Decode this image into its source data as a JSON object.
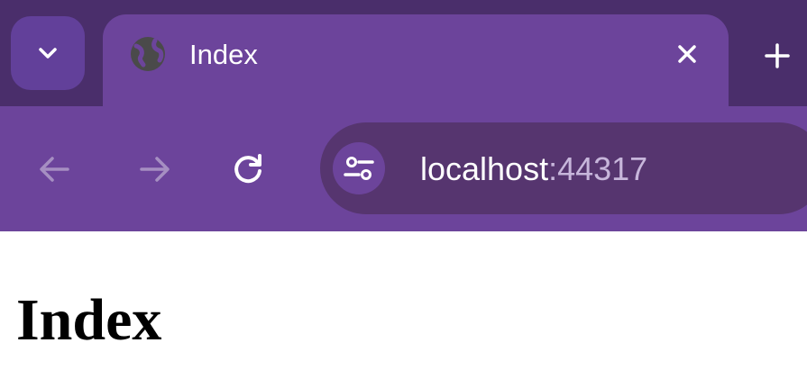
{
  "browser": {
    "tab": {
      "title": "Index",
      "favicon_icon": "globe-icon",
      "close_icon": "close-icon"
    },
    "tab_search_icon": "chevron-down-icon",
    "new_tab_icon": "plus-icon",
    "nav": {
      "back_icon": "arrow-left-icon",
      "forward_icon": "arrow-right-icon",
      "reload_icon": "reload-icon"
    },
    "omnibox": {
      "site_info_icon": "tune-icon",
      "host": "localhost",
      "port": ":44317"
    },
    "colors": {
      "frame": "#4a2e6b",
      "tab_active": "#6c449b",
      "omnibox": "#56356f"
    }
  },
  "page": {
    "heading": "Index"
  }
}
